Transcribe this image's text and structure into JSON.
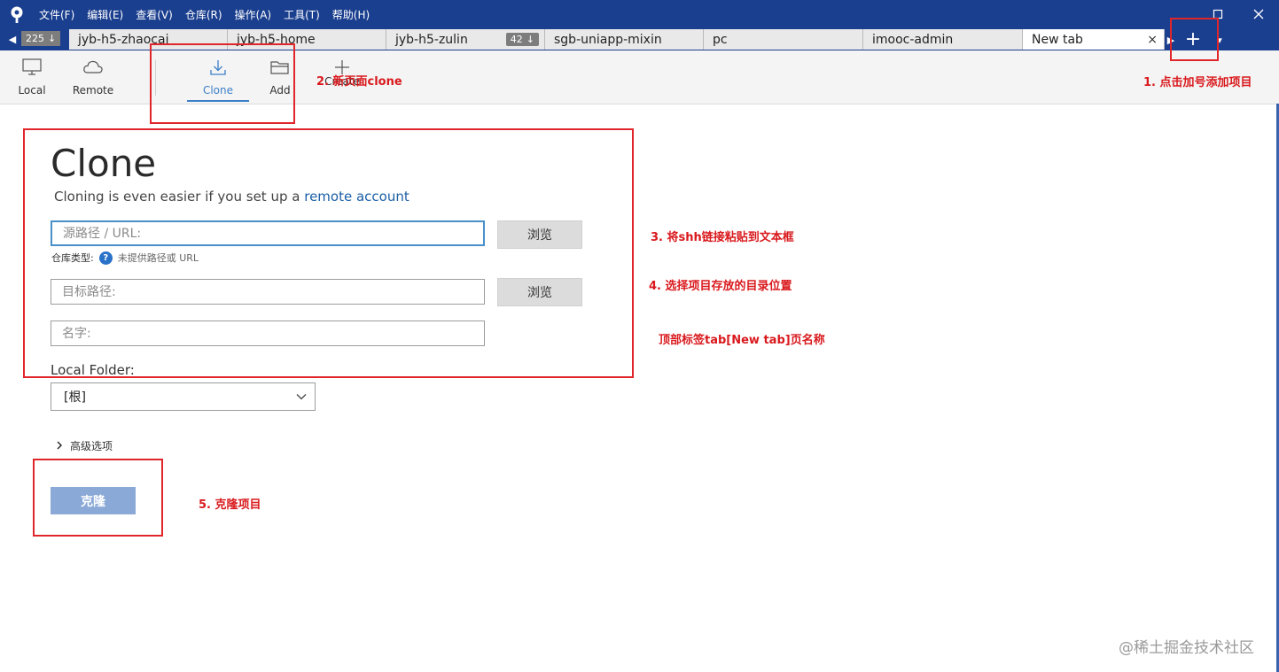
{
  "menu": [
    "文件(F)",
    "编辑(E)",
    "查看(V)",
    "仓库(R)",
    "操作(A)",
    "工具(T)",
    "帮助(H)"
  ],
  "lead_badge": {
    "count": "225",
    "arrow": "↓"
  },
  "tabs": [
    {
      "label": "jyb-h5-zhaocai"
    },
    {
      "label": "jyb-h5-home"
    },
    {
      "label": "jyb-h5-zulin",
      "badge": "42",
      "badge_arrow": "↓"
    },
    {
      "label": "sgb-uniapp-mixin"
    },
    {
      "label": "pc"
    },
    {
      "label": "imooc-admin"
    },
    {
      "label": "New tab",
      "close": "×"
    }
  ],
  "new_tab_button": "+",
  "toolbar": {
    "local": "Local",
    "remote": "Remote",
    "clone": "Clone",
    "add": "Add",
    "create": "Create"
  },
  "clone_page": {
    "title": "Clone",
    "subtitle": "Cloning is even easier if you set up a",
    "subtitle_link": "remote account",
    "source_placeholder": "源路径 / URL:",
    "repo_type_label": "仓库类型:",
    "repo_type_msg": "未提供路径或 URL",
    "browse1": "浏览",
    "dest_placeholder": "目标路径:",
    "browse2": "浏览",
    "name_placeholder": "名字:",
    "local_folder_label": "Local Folder:",
    "local_folder_value": "[根]",
    "advanced": "高级选项",
    "clone_button": "克隆"
  },
  "annotations": {
    "step1": "1. 点击加号添加项目",
    "step2": "2. 新页面clone",
    "step3": "3. 将shh链接粘贴到文本框",
    "step4": "4. 选择项目存放的目录位置",
    "tab_note": "顶部标签tab[New tab]页名称",
    "step5": "5. 克隆项目"
  },
  "watermark": "@稀土掘金技术社区",
  "colors": {
    "titlebar": "#1b3f8f",
    "accent": "#3c7fc8",
    "annotation": "#e0262b",
    "clone_button": "#8aa9d6"
  }
}
